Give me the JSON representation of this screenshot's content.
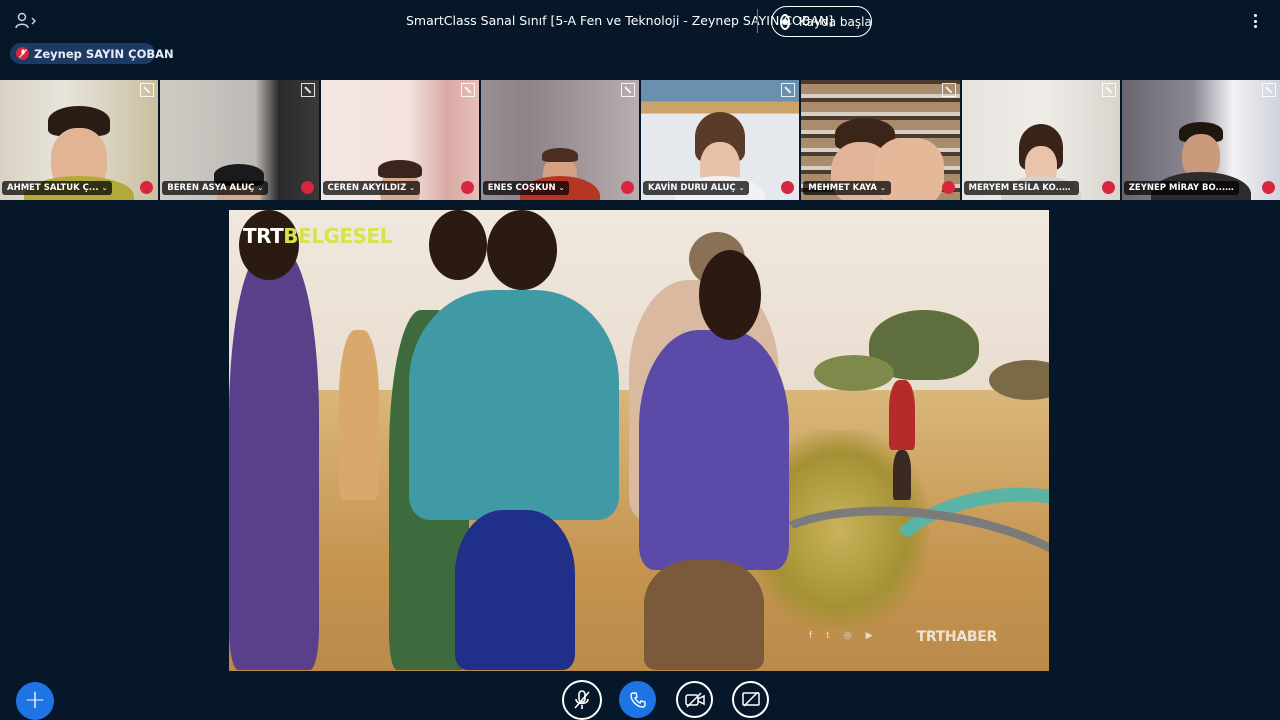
{
  "topbar": {
    "meeting_title": "SmartClass Sanal Sınıf [5-A Fen ve Teknoloji - Zeynep SAYIN ÇOBAN]",
    "record_label": "Kayda başla"
  },
  "presenter": {
    "name": "Zeynep SAYIN ÇOBAN"
  },
  "participants": [
    {
      "name": "AHMET SALTUK Ç..."
    },
    {
      "name": "BEREN ASYA ALUÇ"
    },
    {
      "name": "CEREN AKYILDIZ"
    },
    {
      "name": "ENES COŞKUN"
    },
    {
      "name": "KAVİN DURU ALUÇ"
    },
    {
      "name": "MEHMET KAYA"
    },
    {
      "name": "MERYEM ESİLA KO..."
    },
    {
      "name": "ZEYNEP MİRAY BO..."
    }
  ],
  "screen_share": {
    "brand_main": "TRT",
    "brand_sub": "BELGESEL",
    "brand_bottom": "TRTHABER",
    "social": [
      "f",
      "t",
      "◎",
      "▶"
    ]
  },
  "colors": {
    "background": "#06172a",
    "accent": "#1e74e5",
    "muted_red": "#d7263d"
  },
  "icons": {
    "users": "users-icon",
    "more": "more-vertical-icon",
    "record": "record-icon",
    "mic_muted": "mic-off-icon",
    "call": "phone-icon",
    "camera": "video-off-icon",
    "share": "screen-share-off-icon",
    "expand": "expand-icon",
    "add": "plus-icon"
  }
}
